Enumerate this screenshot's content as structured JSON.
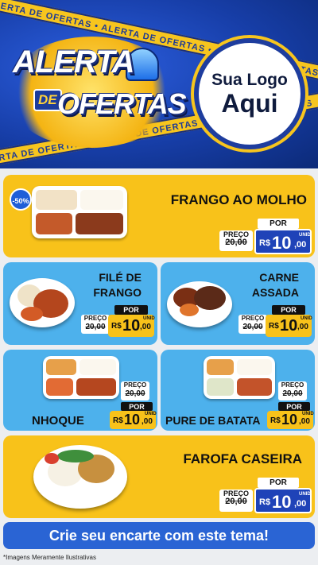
{
  "header": {
    "title_line1": "ALERTA",
    "title_de": "DE",
    "title_line2": "OFERTAS",
    "tape_text": "ALERTA DE OFERTAS • ALERTA DE OFERTAS • ALERTA DE OFERTAS",
    "logo_line1": "Sua Logo",
    "logo_line2": "Aqui"
  },
  "products": [
    {
      "name": "FRANGO AO MOLHO",
      "discount": "-50%",
      "preco_label": "PREÇO",
      "old_price": "20,00",
      "por_label": "POR",
      "currency": "R$",
      "price_int": "10",
      "price_cents": ",00",
      "unit": "UNID"
    },
    {
      "name_line1": "FILÉ DE",
      "name_line2": "FRANGO",
      "preco_label": "PREÇO",
      "old_price": "20,00",
      "por_label": "POR",
      "currency": "R$",
      "price_int": "10",
      "price_cents": ",00",
      "unit": "UNID"
    },
    {
      "name_line1": "CARNE",
      "name_line2": "ASSADA",
      "preco_label": "PREÇO",
      "old_price": "20,00",
      "por_label": "POR",
      "currency": "R$",
      "price_int": "10",
      "price_cents": ",00",
      "unit": "UNID"
    },
    {
      "name": "NHOQUE",
      "preco_label": "PREÇO",
      "old_price": "20,00",
      "por_label": "POR",
      "currency": "R$",
      "price_int": "10",
      "price_cents": ",00",
      "unit": "UNID"
    },
    {
      "name": "PURE DE BATATA",
      "preco_label": "PREÇO",
      "old_price": "20,00",
      "por_label": "POR",
      "currency": "R$",
      "price_int": "10",
      "price_cents": ",00",
      "unit": "UNID"
    },
    {
      "name": "FAROFA CASEIRA",
      "preco_label": "PREÇO",
      "old_price": "20,00",
      "por_label": "POR",
      "currency": "R$",
      "price_int": "10",
      "price_cents": ",00",
      "unit": "UNID"
    }
  ],
  "cta": "Crie seu encarte com este tema!",
  "footnote": "*Imagens Meramente Ilustrativas",
  "colors": {
    "yellow": "#f8c21a",
    "blue": "#4db1ec",
    "navy": "#1f43b8"
  }
}
